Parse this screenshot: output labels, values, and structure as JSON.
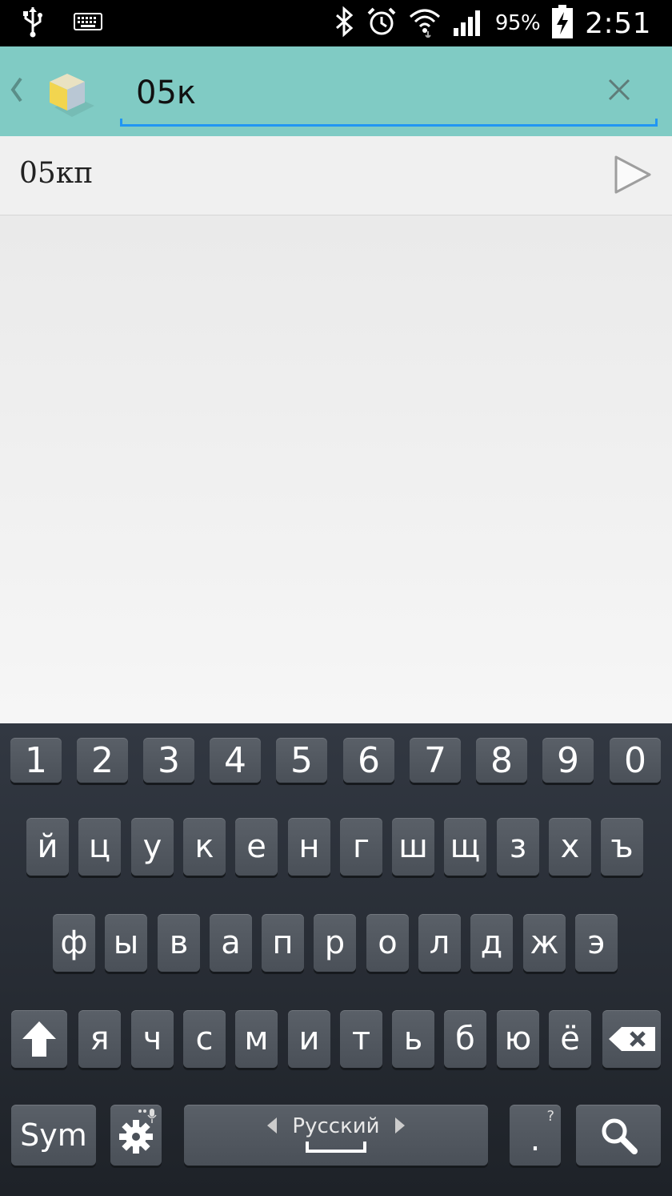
{
  "status_bar": {
    "battery_percent": "95%",
    "time": "2:51",
    "icons": [
      "usb-icon",
      "keyboard-icon",
      "bluetooth-icon",
      "alarm-icon",
      "wifi-icon",
      "signal-icon",
      "battery-charging-icon"
    ]
  },
  "app_bar": {
    "search_value": "05к",
    "icons": [
      "back-icon",
      "app-cube-icon",
      "clear-icon"
    ]
  },
  "results": [
    {
      "label": "05кп"
    }
  ],
  "keyboard": {
    "number_row": [
      "1",
      "2",
      "3",
      "4",
      "5",
      "6",
      "7",
      "8",
      "9",
      "0"
    ],
    "row1": [
      "й",
      "ц",
      "у",
      "к",
      "е",
      "н",
      "г",
      "ш",
      "щ",
      "з",
      "х",
      "ъ"
    ],
    "row2": [
      "ф",
      "ы",
      "в",
      "а",
      "п",
      "р",
      "о",
      "л",
      "д",
      "ж",
      "э"
    ],
    "row3": [
      "я",
      "ч",
      "с",
      "м",
      "и",
      "т",
      "ь",
      "б",
      "ю",
      "ё"
    ],
    "sym_label": "Sym",
    "space_label": "Русский",
    "period_label": ".",
    "period_hint": "?"
  }
}
